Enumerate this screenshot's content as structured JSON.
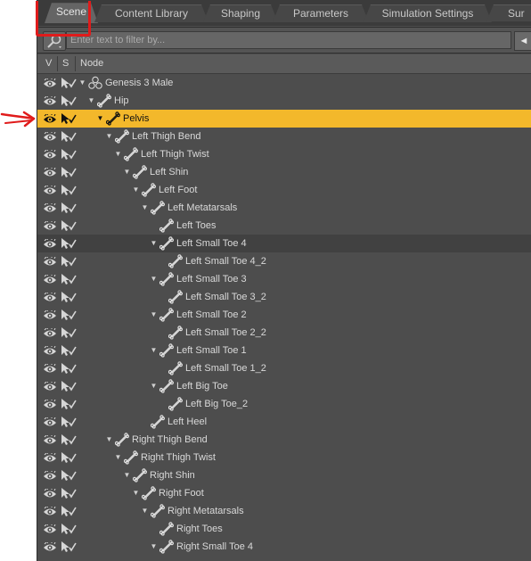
{
  "tabs": [
    {
      "label": "Scene",
      "active": true
    },
    {
      "label": "Content Library",
      "active": false
    },
    {
      "label": "Shaping",
      "active": false
    },
    {
      "label": "Parameters",
      "active": false
    },
    {
      "label": "Simulation Settings",
      "active": false
    },
    {
      "label": "Sur",
      "active": false
    }
  ],
  "filter": {
    "placeholder": "Enter text to filter by..."
  },
  "collapse_button": "◄",
  "columns": {
    "v": "V",
    "s": "S",
    "node": "Node"
  },
  "colors": {
    "selection": "#f3b82b",
    "panel": "#4d4d4d",
    "annotation": "#e01b1b"
  },
  "tree": [
    {
      "label": "Genesis 3 Male",
      "depth": 0,
      "expanded": true,
      "icon": "figure-icon"
    },
    {
      "label": "Hip",
      "depth": 1,
      "expanded": true,
      "icon": "bone-icon"
    },
    {
      "label": "Pelvis",
      "depth": 2,
      "expanded": true,
      "icon": "bone-icon",
      "selected": true
    },
    {
      "label": "Left Thigh Bend",
      "depth": 3,
      "expanded": true,
      "icon": "bone-icon"
    },
    {
      "label": "Left Thigh Twist",
      "depth": 4,
      "expanded": true,
      "icon": "bone-icon"
    },
    {
      "label": "Left Shin",
      "depth": 5,
      "expanded": true,
      "icon": "bone-icon"
    },
    {
      "label": "Left Foot",
      "depth": 6,
      "expanded": true,
      "icon": "bone-icon"
    },
    {
      "label": "Left Metatarsals",
      "depth": 7,
      "expanded": true,
      "icon": "bone-icon"
    },
    {
      "label": "Left Toes",
      "depth": 8,
      "expanded": false,
      "icon": "bone-icon"
    },
    {
      "label": "Left Small Toe 4",
      "depth": 8,
      "expanded": true,
      "icon": "bone-icon",
      "hover": true
    },
    {
      "label": "Left Small Toe 4_2",
      "depth": 9,
      "expanded": false,
      "icon": "bone-icon"
    },
    {
      "label": "Left Small Toe 3",
      "depth": 8,
      "expanded": true,
      "icon": "bone-icon"
    },
    {
      "label": "Left Small Toe 3_2",
      "depth": 9,
      "expanded": false,
      "icon": "bone-icon"
    },
    {
      "label": "Left Small Toe 2",
      "depth": 8,
      "expanded": true,
      "icon": "bone-icon"
    },
    {
      "label": "Left Small Toe 2_2",
      "depth": 9,
      "expanded": false,
      "icon": "bone-icon"
    },
    {
      "label": "Left Small Toe 1",
      "depth": 8,
      "expanded": true,
      "icon": "bone-icon"
    },
    {
      "label": "Left Small Toe 1_2",
      "depth": 9,
      "expanded": false,
      "icon": "bone-icon"
    },
    {
      "label": "Left Big Toe",
      "depth": 8,
      "expanded": true,
      "icon": "bone-icon"
    },
    {
      "label": "Left Big Toe_2",
      "depth": 9,
      "expanded": false,
      "icon": "bone-icon"
    },
    {
      "label": "Left Heel",
      "depth": 7,
      "expanded": false,
      "icon": "bone-icon"
    },
    {
      "label": "Right Thigh Bend",
      "depth": 3,
      "expanded": true,
      "icon": "bone-icon"
    },
    {
      "label": "Right Thigh Twist",
      "depth": 4,
      "expanded": true,
      "icon": "bone-icon"
    },
    {
      "label": "Right Shin",
      "depth": 5,
      "expanded": true,
      "icon": "bone-icon"
    },
    {
      "label": "Right Foot",
      "depth": 6,
      "expanded": true,
      "icon": "bone-icon"
    },
    {
      "label": "Right Metatarsals",
      "depth": 7,
      "expanded": true,
      "icon": "bone-icon"
    },
    {
      "label": "Right Toes",
      "depth": 8,
      "expanded": false,
      "icon": "bone-icon"
    },
    {
      "label": "Right Small Toe 4",
      "depth": 8,
      "expanded": true,
      "icon": "bone-icon"
    }
  ]
}
